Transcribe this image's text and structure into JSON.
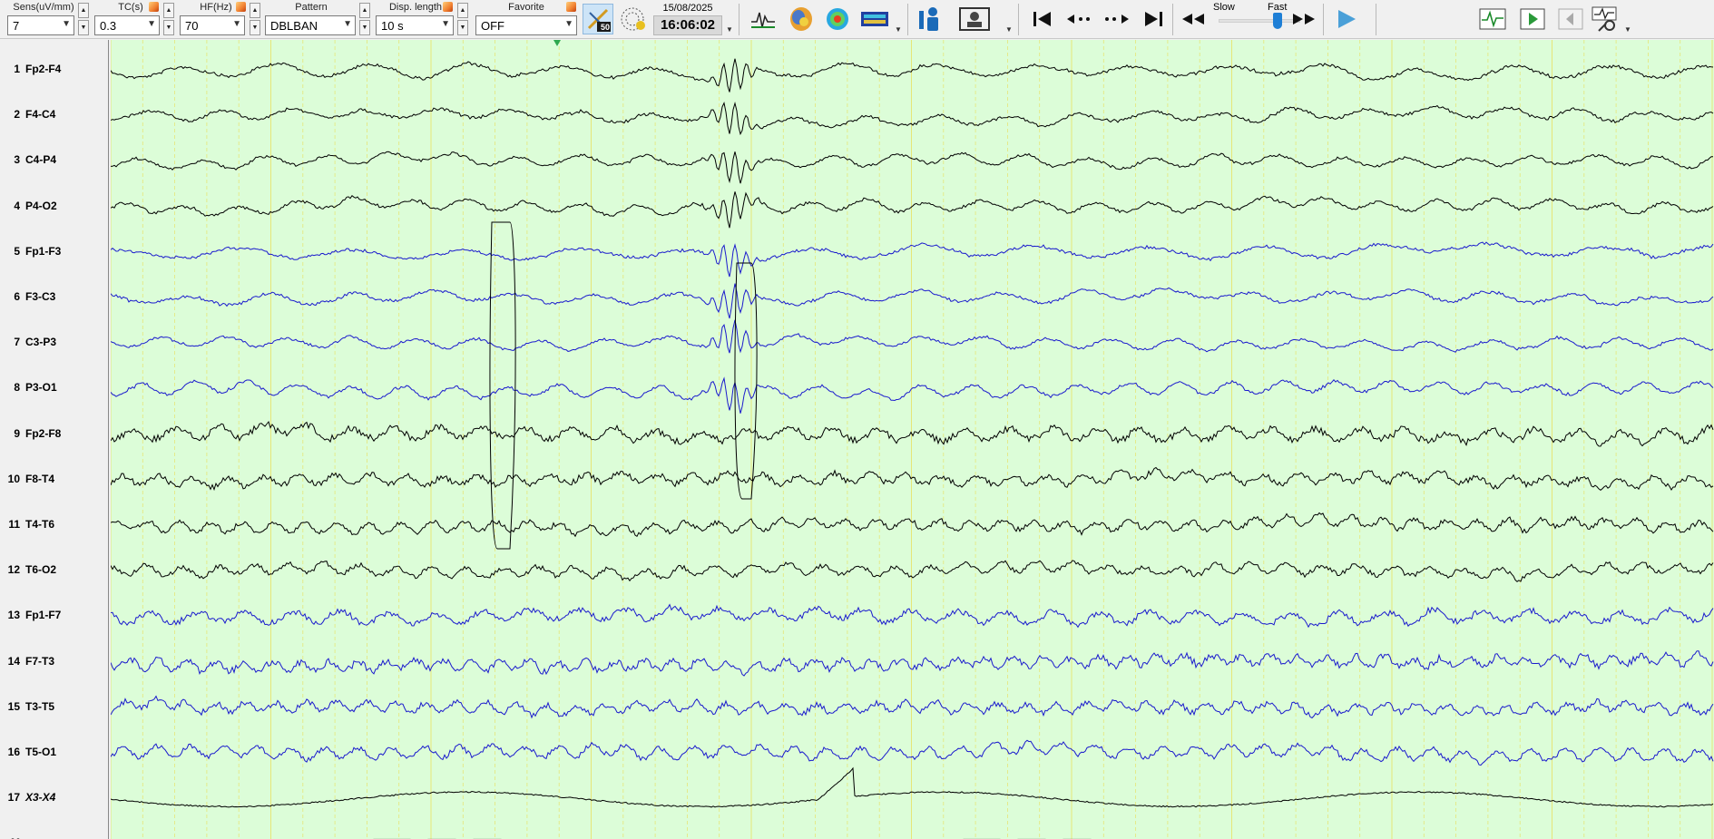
{
  "toolbar": {
    "sens": {
      "label": "Sens(uV/mm)",
      "value": "7"
    },
    "tc": {
      "label": "TC(s)",
      "value": "0.3"
    },
    "hf": {
      "label": "HF(Hz)",
      "value": "70"
    },
    "pattern": {
      "label": "Pattern",
      "value": "DBLBAN"
    },
    "disp_length": {
      "label": "Disp. length",
      "value": "10 s"
    },
    "favorite": {
      "label": "Favorite",
      "value": "OFF"
    },
    "filter_badge": "50",
    "date": "15/08/2025",
    "time": "16:06:02",
    "speed": {
      "slow_label": "Slow",
      "fast_label": "Fast",
      "position": 0.75
    },
    "icons": [
      "auto-filter-icon",
      "electrode-map-icon",
      "waveform-icon",
      "head-map-icon",
      "topography-icon",
      "spectrum-icon",
      "patient-info-icon",
      "video-icon",
      "jump-start-icon",
      "step-back-icon",
      "step-forward-icon",
      "jump-end-icon",
      "rewind-icon",
      "fast-forward-icon",
      "play-icon",
      "montage-icon",
      "marker-icon",
      "page-icon",
      "tools-icon"
    ]
  },
  "channels": [
    {
      "num": "1",
      "name": "Fp2-F4",
      "color": "#000000"
    },
    {
      "num": "2",
      "name": "F4-C4",
      "color": "#000000"
    },
    {
      "num": "3",
      "name": "C4-P4",
      "color": "#000000"
    },
    {
      "num": "4",
      "name": "P4-O2",
      "color": "#000000"
    },
    {
      "num": "5",
      "name": "Fp1-F3",
      "color": "#1a1acd"
    },
    {
      "num": "6",
      "name": "F3-C3",
      "color": "#1a1acd"
    },
    {
      "num": "7",
      "name": "C3-P3",
      "color": "#1a1acd"
    },
    {
      "num": "8",
      "name": "P3-O1",
      "color": "#1a1acd"
    },
    {
      "num": "9",
      "name": "Fp2-F8",
      "color": "#000000"
    },
    {
      "num": "10",
      "name": "F8-T4",
      "color": "#000000"
    },
    {
      "num": "11",
      "name": "T4-T6",
      "color": "#000000"
    },
    {
      "num": "12",
      "name": "T6-O2",
      "color": "#000000"
    },
    {
      "num": "13",
      "name": "Fp1-F7",
      "color": "#1a1acd"
    },
    {
      "num": "14",
      "name": "F7-T3",
      "color": "#1a1acd"
    },
    {
      "num": "15",
      "name": "T3-T5",
      "color": "#1a1acd"
    },
    {
      "num": "16",
      "name": "T5-O1",
      "color": "#1a1acd"
    },
    {
      "num": "17",
      "name": "X3-X4",
      "color": "#000000",
      "italic": true
    },
    {
      "num": "M",
      "name": "",
      "color": "#000000"
    }
  ],
  "colors": {
    "trace_background": "#dcfdd8",
    "grid_line": "#e6e678",
    "left_hemisphere": "#1a1acd",
    "right_hemisphere": "#000000",
    "marker_triangle": "#2fa84f"
  }
}
